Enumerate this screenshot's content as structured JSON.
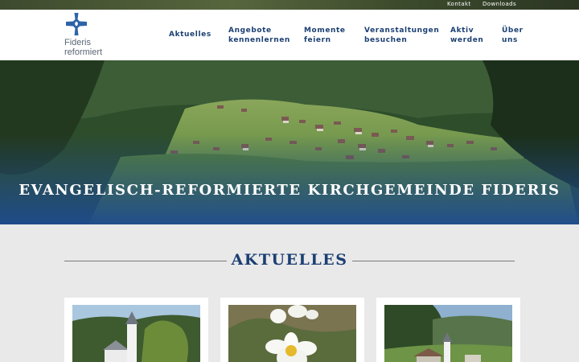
{
  "topbar": {
    "links": [
      "Kontakt",
      "Downloads"
    ]
  },
  "logo": {
    "line1": "Fideris",
    "line2": "reformiert",
    "icon": "cross-logo-icon"
  },
  "nav": {
    "items": [
      "Aktuelles",
      "Angebote\nkennenlernen",
      "Momente\nfeiern",
      "Veranstaltungen\nbesuchen",
      "Aktiv\nwerden",
      "Über\nuns"
    ]
  },
  "hero": {
    "title": "EVANGELISCH-REFORMIERTE KIRCHGEMEINDE FIDERIS"
  },
  "section": {
    "title": "AKTUELLES"
  },
  "colors": {
    "brand_blue": "#1b3f73",
    "logo_blue": "#2e63a8",
    "background": "#e9e9e9"
  }
}
